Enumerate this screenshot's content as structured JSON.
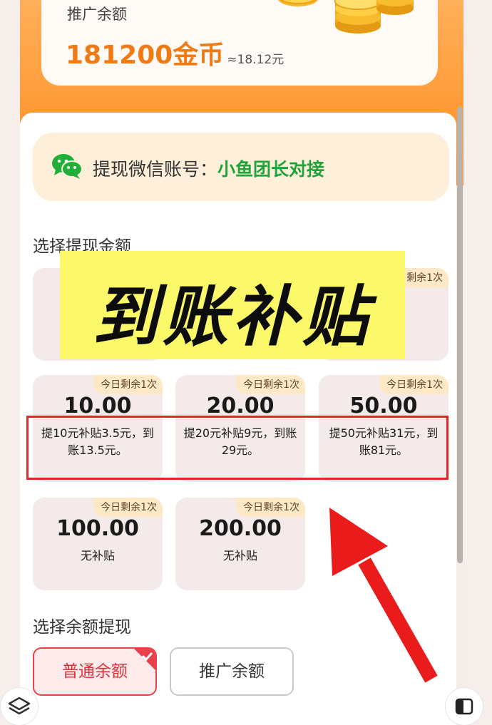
{
  "balance": {
    "label": "推广余额",
    "amount": "181200金币",
    "approx": "≈18.12元"
  },
  "withdraw_account": {
    "label": "提现微信账号：",
    "name": "小鱼团长对接"
  },
  "amount_section": {
    "title": "选择提现金额",
    "hidden_badge": "今日剩余1次",
    "options": [
      {
        "badge": "今日剩余1次",
        "value": "10.00",
        "desc": "提10元补贴3.5元，到账13.5元。"
      },
      {
        "badge": "今日剩余1次",
        "value": "20.00",
        "desc": "提20元补贴9元，到账29元。"
      },
      {
        "badge": "今日剩余1次",
        "value": "50.00",
        "desc": "提50元补贴31元，到账81元。"
      },
      {
        "badge": "今日剩余1次",
        "value": "100.00",
        "desc": "无补贴"
      },
      {
        "badge": "今日剩余1次",
        "value": "200.00",
        "desc": "无补贴"
      }
    ]
  },
  "overlay": {
    "banner_text": "到账补贴"
  },
  "balance_section": {
    "title": "选择余额提现",
    "options": [
      {
        "label": "普通余额",
        "selected": true
      },
      {
        "label": "推广余额",
        "selected": false
      }
    ]
  },
  "colors": {
    "accent_orange": "#f07a14",
    "wechat_green": "#1fa33a",
    "highlight_red": "#e12626",
    "banner_yellow": "#fbf969"
  },
  "icons": [
    "wechat-icon",
    "coins-icon",
    "check-icon",
    "layers-icon",
    "sidebar-icon",
    "arrow-annotation"
  ]
}
